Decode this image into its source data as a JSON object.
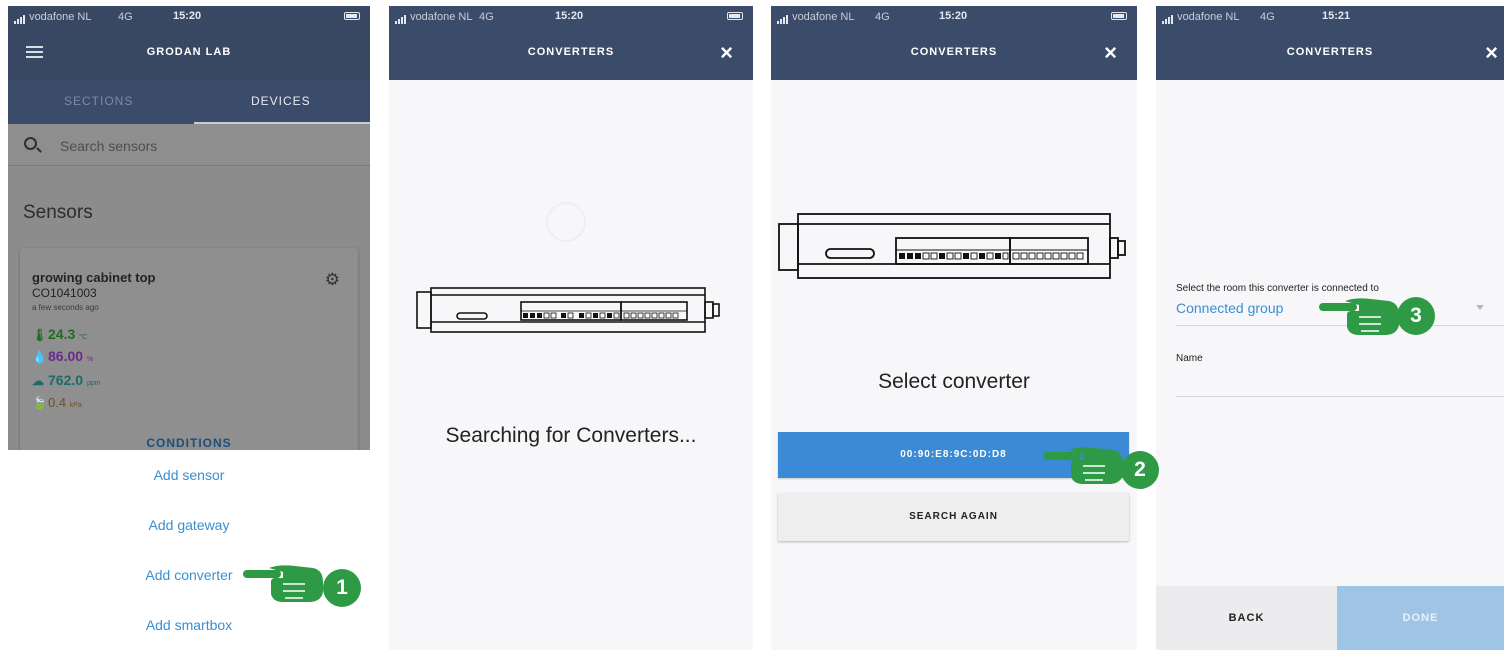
{
  "status_bars": [
    {
      "carrier": "vodafone NL",
      "network": "4G",
      "time": "15:20"
    },
    {
      "carrier": "vodafone NL",
      "network": "4G",
      "time": "15:20"
    },
    {
      "carrier": "vodafone NL",
      "network": "4G",
      "time": "15:20"
    },
    {
      "carrier": "vodafone NL",
      "network": "4G",
      "time": "15:21"
    }
  ],
  "screen1": {
    "app_title": "GRODAN LAB",
    "tabs": {
      "sections": "SECTIONS",
      "devices": "DEVICES"
    },
    "search_placeholder": "Search sensors",
    "sensors_heading": "Sensors",
    "sensor_card": {
      "name": "growing cabinet top",
      "code": "CO1041003",
      "updated": "a few seconds ago",
      "temperature": {
        "value": "24.3",
        "unit": "°C"
      },
      "humidity": {
        "value": "86.00",
        "unit": "%"
      },
      "co2": {
        "value": "762.0",
        "unit": "ppm"
      },
      "vpd": {
        "value": "0.4",
        "unit": "kPa"
      },
      "conditions_link": "CONDITIONS"
    },
    "sheet_items": [
      "Add sensor",
      "Add gateway",
      "Add converter",
      "Add smartbox"
    ]
  },
  "screen2": {
    "title": "CONVERTERS",
    "close_icon": "×",
    "status_text": "Searching for Converters..."
  },
  "screen3": {
    "title": "CONVERTERS",
    "close_icon": "×",
    "heading": "Select converter",
    "converter_mac": "00:90:E8:9C:0D:D8",
    "search_again": "SEARCH AGAIN"
  },
  "screen4": {
    "title": "CONVERTERS",
    "close_icon": "×",
    "room_label": "Select the room this converter is connected to",
    "room_value": "Connected group",
    "name_label": "Name",
    "back": "BACK",
    "done": "DONE"
  },
  "steps": [
    "1",
    "2",
    "3"
  ],
  "colors": {
    "navbar": "#3b4b6a",
    "link_blue": "#3a8fcf",
    "primary_button": "#3a8ad6",
    "done_disabled": "#9fc4e6",
    "step_green": "#2e9a46"
  }
}
